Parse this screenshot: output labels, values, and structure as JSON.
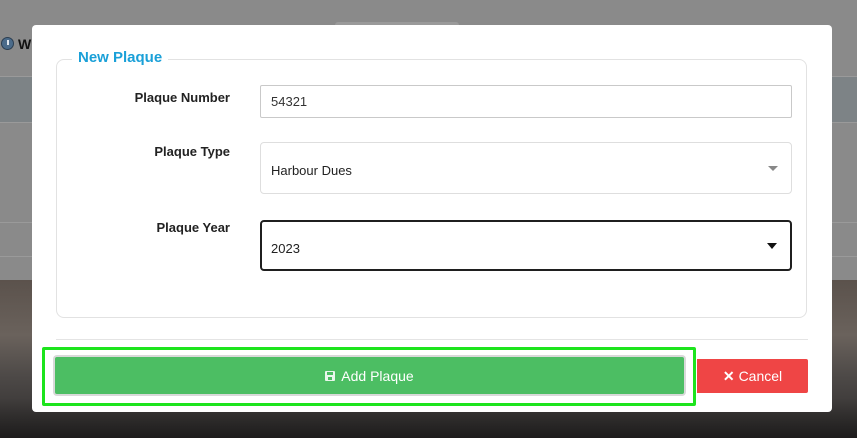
{
  "background": {
    "partial_label": "W"
  },
  "form": {
    "legend": "New Plaque",
    "plaque_number": {
      "label": "Plaque Number",
      "value": "54321"
    },
    "plaque_type": {
      "label": "Plaque Type",
      "selected": "Harbour Dues"
    },
    "plaque_year": {
      "label": "Plaque Year",
      "selected": "2023"
    }
  },
  "buttons": {
    "add": "Add Plaque",
    "cancel": "Cancel",
    "cancel_icon": "✕"
  },
  "colors": {
    "legend": "#1aa0d8",
    "add_button": "#4cbe63",
    "cancel_button": "#ef4545",
    "highlight": "#1de41d"
  }
}
